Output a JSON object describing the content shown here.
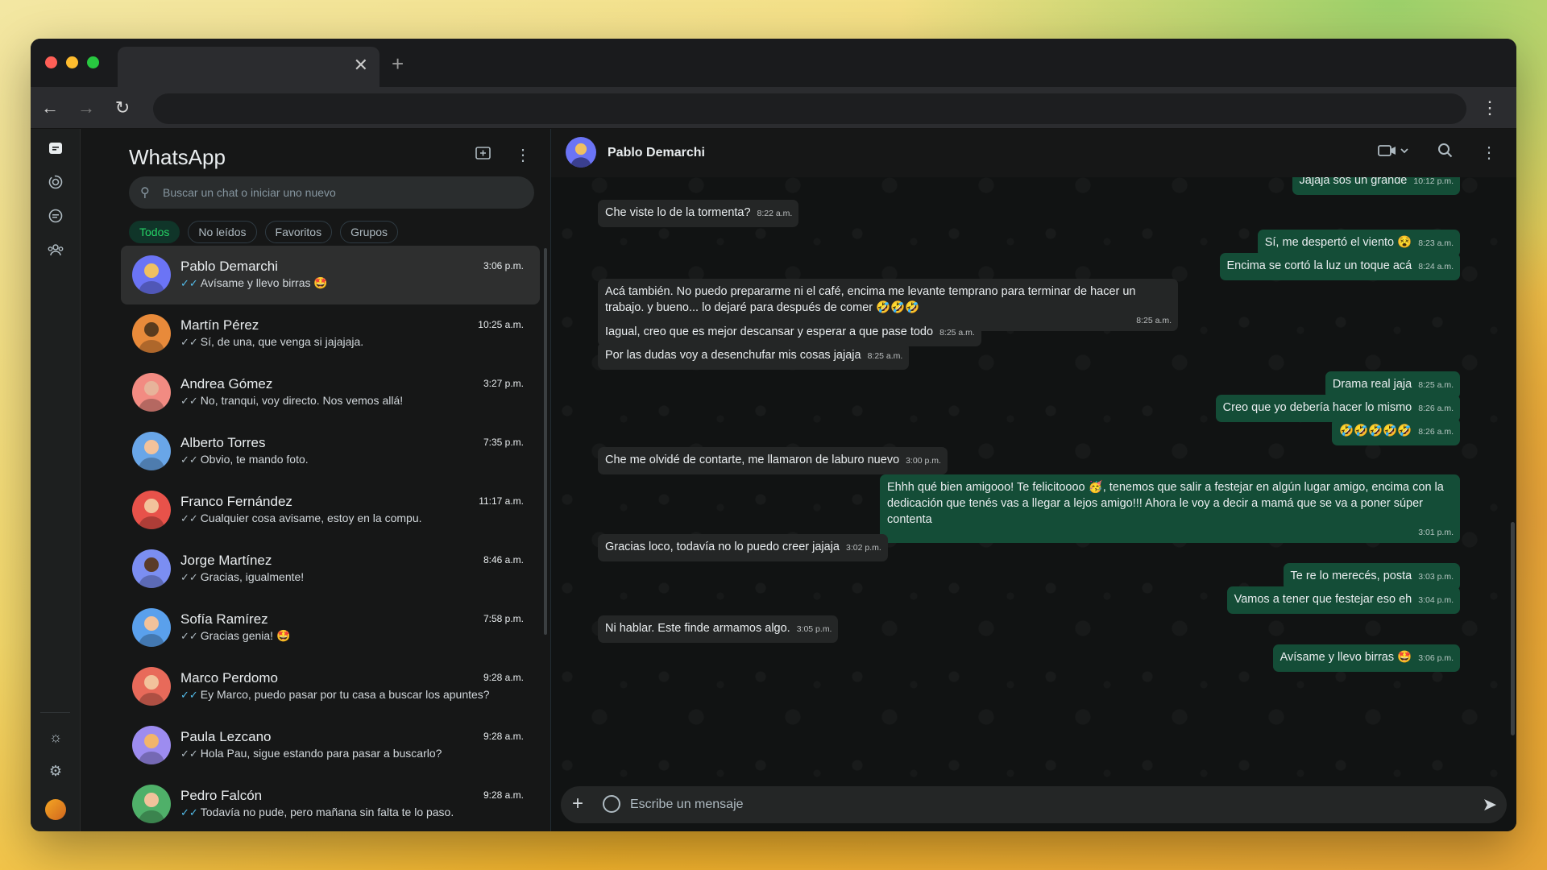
{
  "app": {
    "title": "WhatsApp"
  },
  "search": {
    "placeholder": "Buscar un chat o iniciar uno nuevo"
  },
  "filters": [
    "Todos",
    "No leídos",
    "Favoritos",
    "Grupos"
  ],
  "chats": [
    {
      "name": "Pablo Demarchi",
      "time": "3:06 p.m.",
      "message": "Avísame y llevo birras 🤩",
      "read": true,
      "color1": "#6b74f5",
      "color2": "#f0c061"
    },
    {
      "name": "Martín Pérez",
      "time": "10:25 a.m.",
      "message": "Sí, de una, que venga si jajajaja.",
      "read": false,
      "color1": "#e88a3a",
      "color2": "#5a3b1d"
    },
    {
      "name": "Andrea Gómez",
      "time": "3:27 p.m.",
      "message": "No, tranqui, voy directo. Nos vemos allá!",
      "read": false,
      "color1": "#f28b82",
      "color2": "#e7b39a"
    },
    {
      "name": "Alberto Torres",
      "time": "7:35 p.m.",
      "message": "Obvio, te mando foto.",
      "read": false,
      "color1": "#69a6e8",
      "color2": "#f2c29b"
    },
    {
      "name": "Franco Fernández",
      "time": "11:17 a.m.",
      "message": "Cualquier cosa avisame, estoy en la compu.",
      "read": false,
      "color1": "#e8524a",
      "color2": "#f2c29b"
    },
    {
      "name": "Jorge Martínez",
      "time": "8:46 a.m.",
      "message": "Gracias, igualmente!",
      "read": false,
      "color1": "#7b8ef2",
      "color2": "#5a3b2a"
    },
    {
      "name": "Sofía Ramírez",
      "time": "7:58 p.m.",
      "message": "Gracias genia! 🤩",
      "read": false,
      "color1": "#5aa0ec",
      "color2": "#f2c29b"
    },
    {
      "name": "Marco Perdomo",
      "time": "9:28 a.m.",
      "message": "Ey Marco, puedo pasar por tu casa a buscar los apuntes?",
      "read": true,
      "color1": "#e86a5a",
      "color2": "#f2c29b"
    },
    {
      "name": "Paula Lezcano",
      "time": "9:28 a.m.",
      "message": "Hola Pau, sigue estando para pasar a buscarlo?",
      "read": false,
      "color1": "#9d8cf0",
      "color2": "#f2b56b"
    },
    {
      "name": "Pedro Falcón",
      "time": "9:28 a.m.",
      "message": "Todavía no pude, pero mañana sin falta te lo paso.",
      "read": true,
      "color1": "#4fb069",
      "color2": "#f2c29b"
    }
  ],
  "conversation": {
    "contact": "Pablo Demarchi",
    "messages": [
      {
        "dir": "out",
        "text": "Jajaja sos un grande",
        "time": "10:12 p.m."
      },
      {
        "dir": "in",
        "text": "Che viste lo de la tormenta?",
        "time": "8:22 a.m."
      },
      {
        "dir": "out",
        "text": "Sí, me despertó el viento 😵",
        "time": "8:23 a.m."
      },
      {
        "dir": "out",
        "text": "Encima se cortó la luz un toque acá",
        "time": "8:24 a.m."
      },
      {
        "dir": "in",
        "text": "Acá también. No puedo prepararme ni el café, encima me levante temprano para terminar de hacer un trabajo. y bueno... lo dejaré para después de comer 🤣🤣🤣",
        "time": "8:25 a.m."
      },
      {
        "dir": "in",
        "text": "Iagual, creo que es mejor descansar y esperar a que pase todo",
        "time": "8:25 a.m."
      },
      {
        "dir": "in",
        "text": "Por las dudas voy a desenchufar mis cosas jajaja",
        "time": "8:25 a.m."
      },
      {
        "dir": "out",
        "text": "Drama real jaja",
        "time": "8:25 a.m."
      },
      {
        "dir": "out",
        "text": "Creo que yo debería hacer lo mismo",
        "time": "8:26 a.m."
      },
      {
        "dir": "out",
        "text": "🤣🤣🤣🤣🤣",
        "time": "8:26 a.m."
      },
      {
        "dir": "in",
        "text": "Che me olvidé de contarte, me llamaron de laburo nuevo",
        "time": "3:00 p.m."
      },
      {
        "dir": "out",
        "text": "Ehhh qué bien amigooo! Te felicitoooo 🥳, tenemos que salir a festejar en algún lugar amigo, encima con la dedicación que tenés vas a llegar a lejos amigo!!! Ahora le voy a decir a mamá que se va a poner súper contenta",
        "time": "3:01 p.m."
      },
      {
        "dir": "in",
        "text": "Gracias loco, todavía no lo puedo creer jajaja",
        "time": "3:02 p.m."
      },
      {
        "dir": "out",
        "text": "Te re lo merecés, posta",
        "time": "3:03 p.m."
      },
      {
        "dir": "out",
        "text": "Vamos a tener que festejar eso eh",
        "time": "3:04 p.m."
      },
      {
        "dir": "in",
        "text": "Ni hablar. Este finde armamos algo.",
        "time": "3:05 p.m."
      },
      {
        "dir": "out",
        "text": "Avísame y llevo birras 🤩",
        "time": "3:06 p.m."
      }
    ]
  },
  "composer": {
    "placeholder": "Escribe un mensaje"
  },
  "icons": {
    "browser_back": "arrow-left-icon",
    "browser_forward": "arrow-right-icon",
    "reload": "reload-icon",
    "new_chat": "new-chat-icon",
    "video_call": "video-camera-icon",
    "search": "search-icon",
    "send": "send-icon"
  }
}
